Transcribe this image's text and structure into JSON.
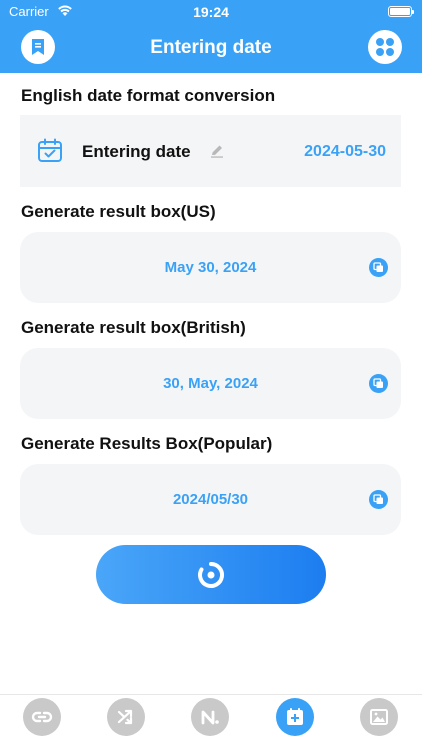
{
  "status_bar": {
    "carrier": "Carrier",
    "time": "19:24"
  },
  "header": {
    "title": "Entering date"
  },
  "input_section": {
    "title": "English date format conversion",
    "label": "Entering date",
    "date_value": "2024-05-30"
  },
  "results": [
    {
      "title": "Generate result box(US)",
      "value": "May 30, 2024"
    },
    {
      "title": "Generate result box(British)",
      "value": "30, May, 2024"
    },
    {
      "title": "Generate Results Box(Popular)",
      "value": "2024/05/30"
    }
  ],
  "tab_bar": {
    "tabs": [
      {
        "icon": "link-icon",
        "active": false
      },
      {
        "icon": "shuffle-icon",
        "active": false
      },
      {
        "icon": "n-letter-icon",
        "active": false
      },
      {
        "icon": "calendar-add-icon",
        "active": true
      },
      {
        "icon": "image-icon",
        "active": false
      }
    ]
  },
  "colors": {
    "accent": "#3aa2f6",
    "card_bg": "#f4f5f7",
    "tab_inactive": "#c9c9c9"
  }
}
